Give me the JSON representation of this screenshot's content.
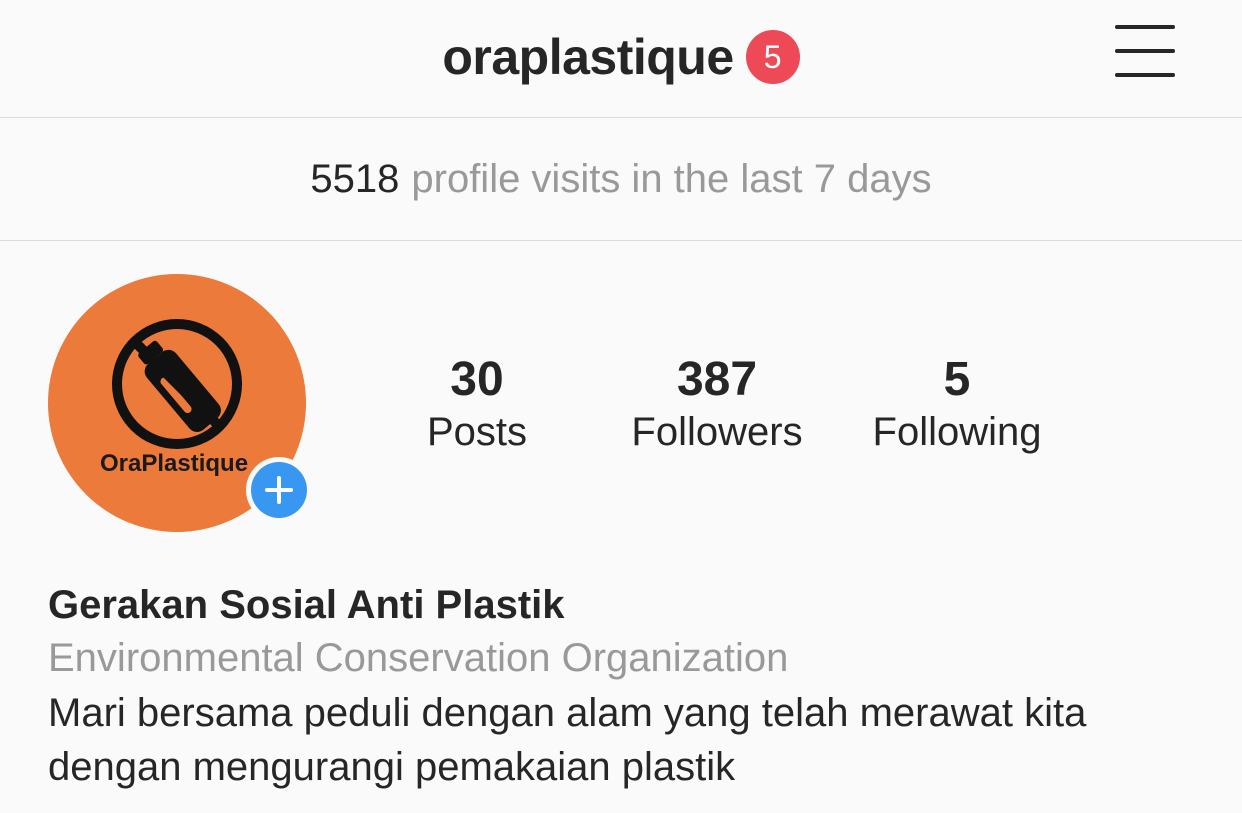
{
  "header": {
    "username": "oraplastique",
    "notification_count": "5",
    "menu_icon": "hamburger-menu-icon"
  },
  "insights": {
    "visits_count": "5518",
    "visits_text": "profile visits in the last 7 days"
  },
  "profile": {
    "avatar_text": "OraPlastique",
    "avatar_color": "#ec7a3a",
    "add_story_icon": "plus-icon",
    "accent_color": "#3897f0",
    "badge_color": "#ed4956"
  },
  "stats": {
    "posts": {
      "value": "30",
      "label": "Posts"
    },
    "followers": {
      "value": "387",
      "label": "Followers"
    },
    "following": {
      "value": "5",
      "label": "Following"
    }
  },
  "bio": {
    "name": "Gerakan Sosial Anti Plastik",
    "category": "Environmental Conservation Organization",
    "text": "Mari bersama peduli dengan alam yang telah merawat kita dengan mengurangi pemakaian plastik"
  }
}
